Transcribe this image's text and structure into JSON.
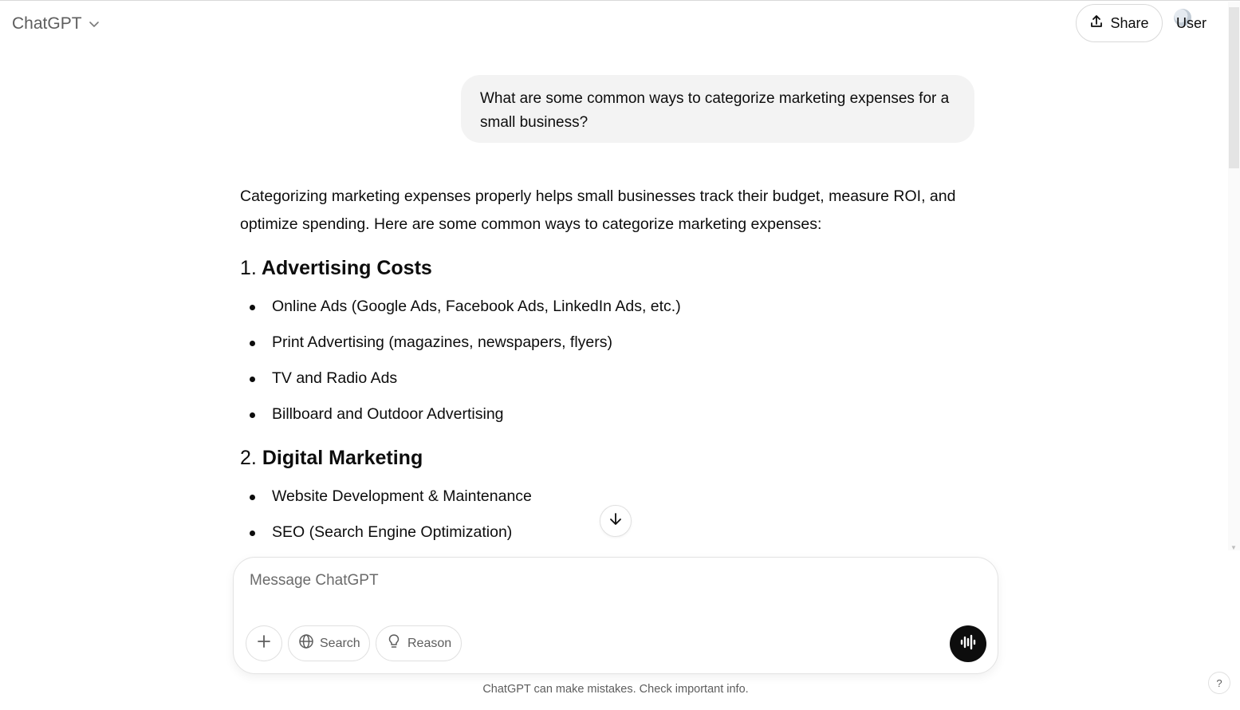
{
  "header": {
    "model_name": "ChatGPT",
    "share_label": "Share",
    "user_label": "User"
  },
  "conversation": {
    "user_message": "What are some common ways to categorize marketing expenses for a small business?",
    "assistant": {
      "intro": "Categorizing marketing expenses properly helps small businesses track their budget, measure ROI, and optimize spending. Here are some common ways to categorize marketing expenses:",
      "sections": [
        {
          "number": "1.",
          "title": "Advertising Costs",
          "items": [
            "Online Ads (Google Ads, Facebook Ads, LinkedIn Ads, etc.)",
            "Print Advertising (magazines, newspapers, flyers)",
            "TV and Radio Ads",
            "Billboard and Outdoor Advertising"
          ]
        },
        {
          "number": "2.",
          "title": "Digital Marketing",
          "items": [
            "Website Development & Maintenance",
            "SEO (Search Engine Optimization)"
          ]
        }
      ]
    }
  },
  "composer": {
    "placeholder": "Message ChatGPT",
    "search_label": "Search",
    "reason_label": "Reason"
  },
  "footer": {
    "disclaimer": "ChatGPT can make mistakes. Check important info.",
    "help_label": "?"
  },
  "icons": {
    "model_switch": "chevron-down-icon",
    "share": "upload-icon",
    "scroll_down": "arrow-down-icon",
    "attach": "plus-icon",
    "search": "globe-icon",
    "reason": "lightbulb-icon",
    "voice": "voice-wave-icon"
  }
}
